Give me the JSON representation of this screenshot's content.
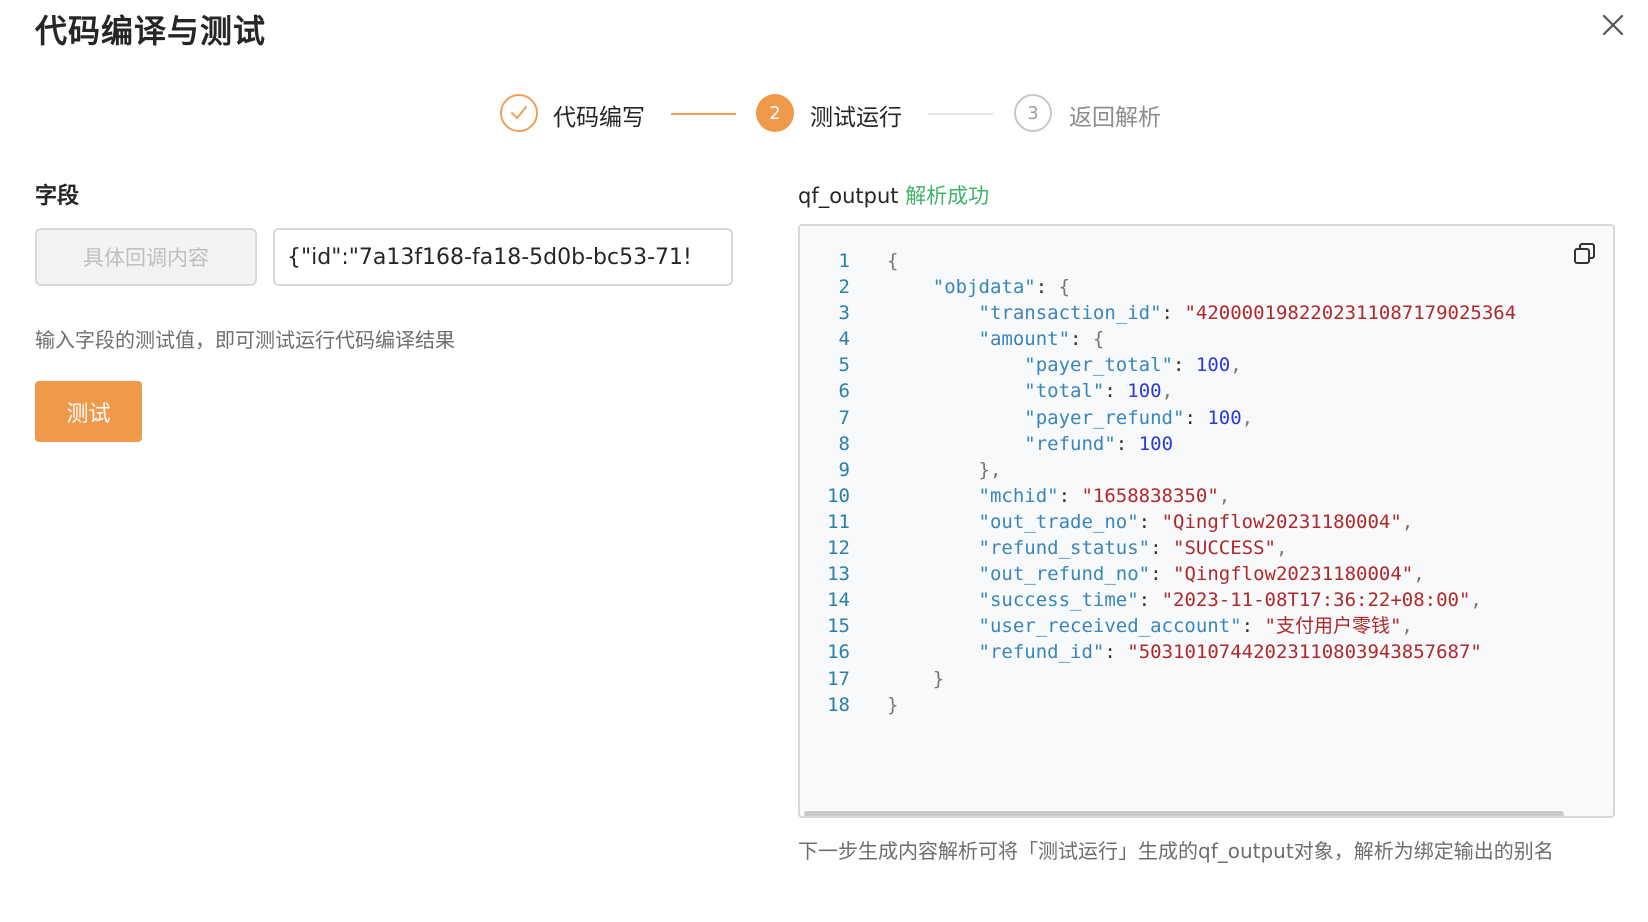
{
  "dialog": {
    "title": "代码编译与测试"
  },
  "steps": [
    {
      "index": "1",
      "label": "代码编写",
      "status": "done"
    },
    {
      "index": "2",
      "label": "测试运行",
      "status": "active"
    },
    {
      "index": "3",
      "label": "返回解析",
      "status": "pending"
    }
  ],
  "colors": {
    "accent": "#f0994a",
    "success": "#3fb36a",
    "string": "#b0292a",
    "number": "#2e3bd1",
    "key": "#3a86b8"
  },
  "left": {
    "section_label": "字段",
    "field_name_placeholder": "具体回调内容",
    "field_value": "{\"id\":\"7a13f168-fa18-5d0b-bc53-71!",
    "hint": "输入字段的测试值，即可测试运行代码编译结果",
    "test_button": "测试"
  },
  "right": {
    "output_name": "qf_output",
    "output_status": "解析成功",
    "copy_icon": "copy-icon",
    "footer_note": "下一步生成内容解析可将「测试运行」生成的qf_output对象，解析为绑定输出的别名"
  },
  "code": [
    {
      "ln": "1",
      "indent": "",
      "key": "",
      "sep": "",
      "value": "",
      "vtype": "",
      "tail": "{"
    },
    {
      "ln": "2",
      "indent": "    ",
      "key": "\"objdata\"",
      "sep": ": ",
      "value": "",
      "vtype": "",
      "tail": "{"
    },
    {
      "ln": "3",
      "indent": "        ",
      "key": "\"transaction_id\"",
      "sep": ": ",
      "value": "\"4200001982202311087179025364",
      "vtype": "str",
      "tail": ""
    },
    {
      "ln": "4",
      "indent": "        ",
      "key": "\"amount\"",
      "sep": ": ",
      "value": "",
      "vtype": "",
      "tail": "{"
    },
    {
      "ln": "5",
      "indent": "            ",
      "key": "\"payer_total\"",
      "sep": ": ",
      "value": "100",
      "vtype": "num",
      "tail": ","
    },
    {
      "ln": "6",
      "indent": "            ",
      "key": "\"total\"",
      "sep": ": ",
      "value": "100",
      "vtype": "num",
      "tail": ","
    },
    {
      "ln": "7",
      "indent": "            ",
      "key": "\"payer_refund\"",
      "sep": ": ",
      "value": "100",
      "vtype": "num",
      "tail": ","
    },
    {
      "ln": "8",
      "indent": "            ",
      "key": "\"refund\"",
      "sep": ": ",
      "value": "100",
      "vtype": "num",
      "tail": ""
    },
    {
      "ln": "9",
      "indent": "        ",
      "key": "",
      "sep": "",
      "value": "",
      "vtype": "",
      "tail": "},"
    },
    {
      "ln": "10",
      "indent": "        ",
      "key": "\"mchid\"",
      "sep": ": ",
      "value": "\"1658838350\"",
      "vtype": "str",
      "tail": ","
    },
    {
      "ln": "11",
      "indent": "        ",
      "key": "\"out_trade_no\"",
      "sep": ": ",
      "value": "\"Qingflow20231180004\"",
      "vtype": "str",
      "tail": ","
    },
    {
      "ln": "12",
      "indent": "        ",
      "key": "\"refund_status\"",
      "sep": ": ",
      "value": "\"SUCCESS\"",
      "vtype": "str",
      "tail": ","
    },
    {
      "ln": "13",
      "indent": "        ",
      "key": "\"out_refund_no\"",
      "sep": ": ",
      "value": "\"Qingflow20231180004\"",
      "vtype": "str",
      "tail": ","
    },
    {
      "ln": "14",
      "indent": "        ",
      "key": "\"success_time\"",
      "sep": ": ",
      "value": "\"2023-11-08T17:36:22+08:00\"",
      "vtype": "str",
      "tail": ","
    },
    {
      "ln": "15",
      "indent": "        ",
      "key": "\"user_received_account\"",
      "sep": ": ",
      "value": "\"支付用户零钱\"",
      "vtype": "str",
      "tail": ","
    },
    {
      "ln": "16",
      "indent": "        ",
      "key": "\"refund_id\"",
      "sep": ": ",
      "value": "\"50310107442023110803943857687\"",
      "vtype": "str",
      "tail": ""
    },
    {
      "ln": "17",
      "indent": "    ",
      "key": "",
      "sep": "",
      "value": "",
      "vtype": "",
      "tail": "}"
    },
    {
      "ln": "18",
      "indent": "",
      "key": "",
      "sep": "",
      "value": "",
      "vtype": "",
      "tail": "}"
    }
  ]
}
